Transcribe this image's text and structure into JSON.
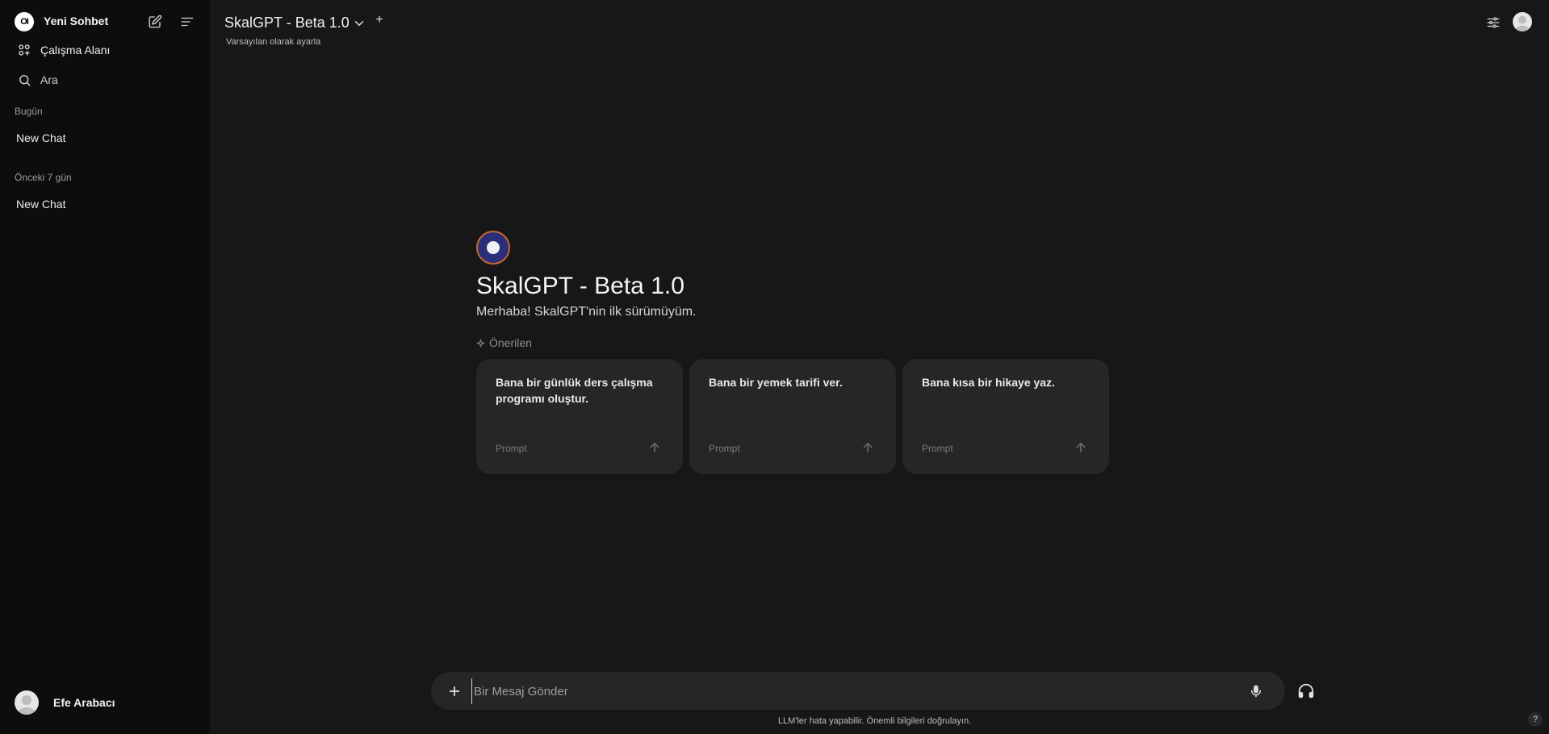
{
  "sidebar": {
    "logo_text": "OI",
    "app_name": "Yeni Sohbet",
    "workspace_label": "Çalışma Alanı",
    "search_label": "Ara",
    "groups": [
      {
        "label": "Bugün",
        "chats": [
          "New Chat"
        ]
      },
      {
        "label": "Önceki 7 gün",
        "chats": [
          "New Chat"
        ]
      }
    ],
    "user_name": "Efe Arabacı"
  },
  "header": {
    "model_title": "SkalGPT - Beta 1.0",
    "add_label": "+",
    "set_default": "Varsayılan olarak ayarla"
  },
  "main": {
    "title": "SkalGPT - Beta 1.0",
    "subtitle": "Merhaba! SkalGPT'nin ilk sürümüyüm.",
    "suggested_label": "Önerilen",
    "suggestions": [
      {
        "text": "Bana bir günlük ders çalışma programı oluştur.",
        "tag": "Prompt"
      },
      {
        "text": "Bana bir yemek tarifi ver.",
        "tag": "Prompt"
      },
      {
        "text": "Bana kısa bir hikaye yaz.",
        "tag": "Prompt"
      }
    ]
  },
  "input": {
    "placeholder": "Bir Mesaj Gönder",
    "value": ""
  },
  "footer": {
    "disclaimer": "LLM'ler hata yapabilir. Önemli bilgileri doğrulayın.",
    "help_label": "?"
  },
  "colors": {
    "background": "#171717",
    "sidebar": "#0d0d0d",
    "card": "#262626",
    "logo_ring": "#c7662e",
    "logo_fill": "#2b2f7a"
  }
}
